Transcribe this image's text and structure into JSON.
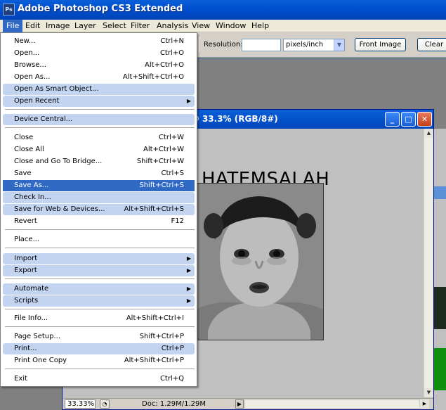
{
  "app": {
    "title": "Adobe Photoshop CS3 Extended",
    "icon_text": "Ps"
  },
  "menubar": [
    {
      "label": "File"
    },
    {
      "label": "Edit"
    },
    {
      "label": "Image"
    },
    {
      "label": "Layer"
    },
    {
      "label": "Select"
    },
    {
      "label": "Filter"
    },
    {
      "label": "Analysis"
    },
    {
      "label": "View"
    },
    {
      "label": "Window"
    },
    {
      "label": "Help"
    }
  ],
  "options": {
    "resolution_label": "Resolution:",
    "resolution_value": "",
    "units": "pixels/inch",
    "front_image": "Front Image",
    "clear": "Clear"
  },
  "file_menu": {
    "items": [
      {
        "label": "New...",
        "shortcut": "Ctrl+N"
      },
      {
        "label": "Open...",
        "shortcut": "Ctrl+O"
      },
      {
        "label": "Browse...",
        "shortcut": "Alt+Ctrl+O"
      },
      {
        "label": "Open As...",
        "shortcut": "Alt+Shift+Ctrl+O"
      },
      {
        "label": "Open As Smart Object...",
        "shortcut": ""
      },
      {
        "label": "Open Recent",
        "shortcut": ""
      },
      {
        "label": "Device Central...",
        "shortcut": ""
      },
      {
        "label": "Close",
        "shortcut": "Ctrl+W"
      },
      {
        "label": "Close All",
        "shortcut": "Alt+Ctrl+W"
      },
      {
        "label": "Close and Go To Bridge...",
        "shortcut": "Shift+Ctrl+W"
      },
      {
        "label": "Save",
        "shortcut": "Ctrl+S"
      },
      {
        "label": "Save As...",
        "shortcut": "Shift+Ctrl+S"
      },
      {
        "label": "Check In...",
        "shortcut": ""
      },
      {
        "label": "Save for Web & Devices...",
        "shortcut": "Alt+Shift+Ctrl+S"
      },
      {
        "label": "Revert",
        "shortcut": "F12"
      },
      {
        "label": "Place...",
        "shortcut": ""
      },
      {
        "label": "Import",
        "shortcut": ""
      },
      {
        "label": "Export",
        "shortcut": ""
      },
      {
        "label": "Automate",
        "shortcut": ""
      },
      {
        "label": "Scripts",
        "shortcut": ""
      },
      {
        "label": "File Info...",
        "shortcut": "Alt+Shift+Ctrl+I"
      },
      {
        "label": "Page Setup...",
        "shortcut": "Shift+Ctrl+P"
      },
      {
        "label": "Print...",
        "shortcut": "Ctrl+P"
      },
      {
        "label": "Print One Copy",
        "shortcut": "Alt+Shift+Ctrl+P"
      },
      {
        "label": "Exit",
        "shortcut": "Ctrl+Q"
      }
    ],
    "submenu_arrow": "▶"
  },
  "document": {
    "title": "g @ 33.3% (RGB/8#)",
    "image_text": "HATEMSALAH",
    "zoom": "33.33%",
    "doc_info": "Doc: 1.29M/1.29M"
  },
  "window_buttons": {
    "minimize": "_",
    "maximize": "□",
    "close": "✕"
  },
  "colors": {
    "titlebar": "#0050d0",
    "menu_selection": "#316ac5",
    "menu_highlight": "#c2d4f0"
  }
}
